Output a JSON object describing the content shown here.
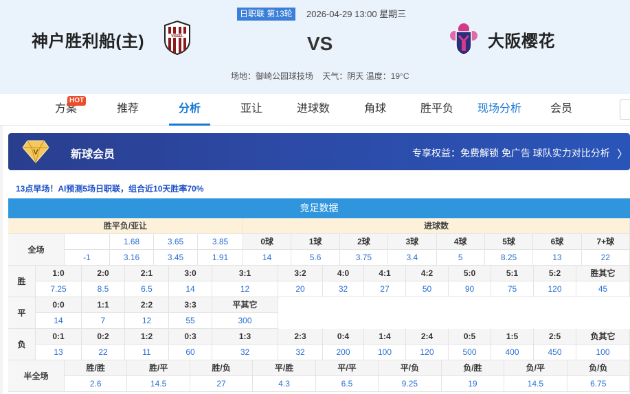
{
  "match": {
    "league_round": "日职联 第13轮",
    "datetime": "2026-04-29 13:00 星期三",
    "home": "神户胜利船(主)",
    "away": "大阪樱花",
    "vs": "VS",
    "venue": "场地：御崎公园球技场",
    "weather": "天气：阴天 温度：19°C",
    "home_logo_text": "VISSEL"
  },
  "tabs": [
    {
      "label": "方案"
    },
    {
      "label": "推荐"
    },
    {
      "label": "分析"
    },
    {
      "label": "亚让"
    },
    {
      "label": "进球数"
    },
    {
      "label": "角球"
    },
    {
      "label": "胜平负"
    },
    {
      "label": "现场分析"
    },
    {
      "label": "会员"
    }
  ],
  "hot_badge": "HOT",
  "banner": {
    "title": "新球会员",
    "perks": "专享权益：免费解锁 免广告 球队实力对比分析",
    "chevron": "〉"
  },
  "promo": "13点早场！AI预测5场日职联，组合近10天胜率70%",
  "table": {
    "title": "竞足数据",
    "left_header": "胜平负/亚让",
    "right_header": "进球数",
    "full_label": "全场",
    "full_row1": [
      "",
      "1.68",
      "3.65",
      "3.85"
    ],
    "full_row2": [
      "-1",
      "3.16",
      "3.45",
      "1.91"
    ],
    "goals_heads": [
      "0球",
      "1球",
      "2球",
      "3球",
      "4球",
      "5球",
      "6球",
      "7+球"
    ],
    "goals_vals": [
      "14",
      "5.6",
      "3.75",
      "3.4",
      "5",
      "8.25",
      "13",
      "22"
    ],
    "win_label": "胜",
    "win_heads": [
      "1:0",
      "2:0",
      "2:1",
      "3:0",
      "3:1",
      "3:2",
      "4:0",
      "4:1",
      "4:2",
      "5:0",
      "5:1",
      "5:2",
      "胜其它"
    ],
    "win_vals": [
      "7.25",
      "8.5",
      "6.5",
      "14",
      "12",
      "20",
      "32",
      "27",
      "50",
      "90",
      "75",
      "120",
      "45"
    ],
    "draw_label": "平",
    "draw_heads": [
      "0:0",
      "1:1",
      "2:2",
      "3:3",
      "平其它"
    ],
    "draw_vals": [
      "14",
      "7",
      "12",
      "55",
      "300"
    ],
    "lose_label": "负",
    "lose_heads": [
      "0:1",
      "0:2",
      "1:2",
      "0:3",
      "1:3",
      "2:3",
      "0:4",
      "1:4",
      "2:4",
      "0:5",
      "1:5",
      "2:5",
      "负其它"
    ],
    "lose_vals": [
      "13",
      "22",
      "11",
      "60",
      "32",
      "32",
      "200",
      "100",
      "120",
      "500",
      "400",
      "450",
      "100"
    ],
    "half_label": "半全场",
    "half_heads": [
      "胜/胜",
      "胜/平",
      "胜/负",
      "平/胜",
      "平/平",
      "平/负",
      "负/胜",
      "负/平",
      "负/负"
    ],
    "half_vals": [
      "2.6",
      "14.5",
      "27",
      "4.3",
      "6.5",
      "9.25",
      "19",
      "14.5",
      "6.75"
    ]
  }
}
